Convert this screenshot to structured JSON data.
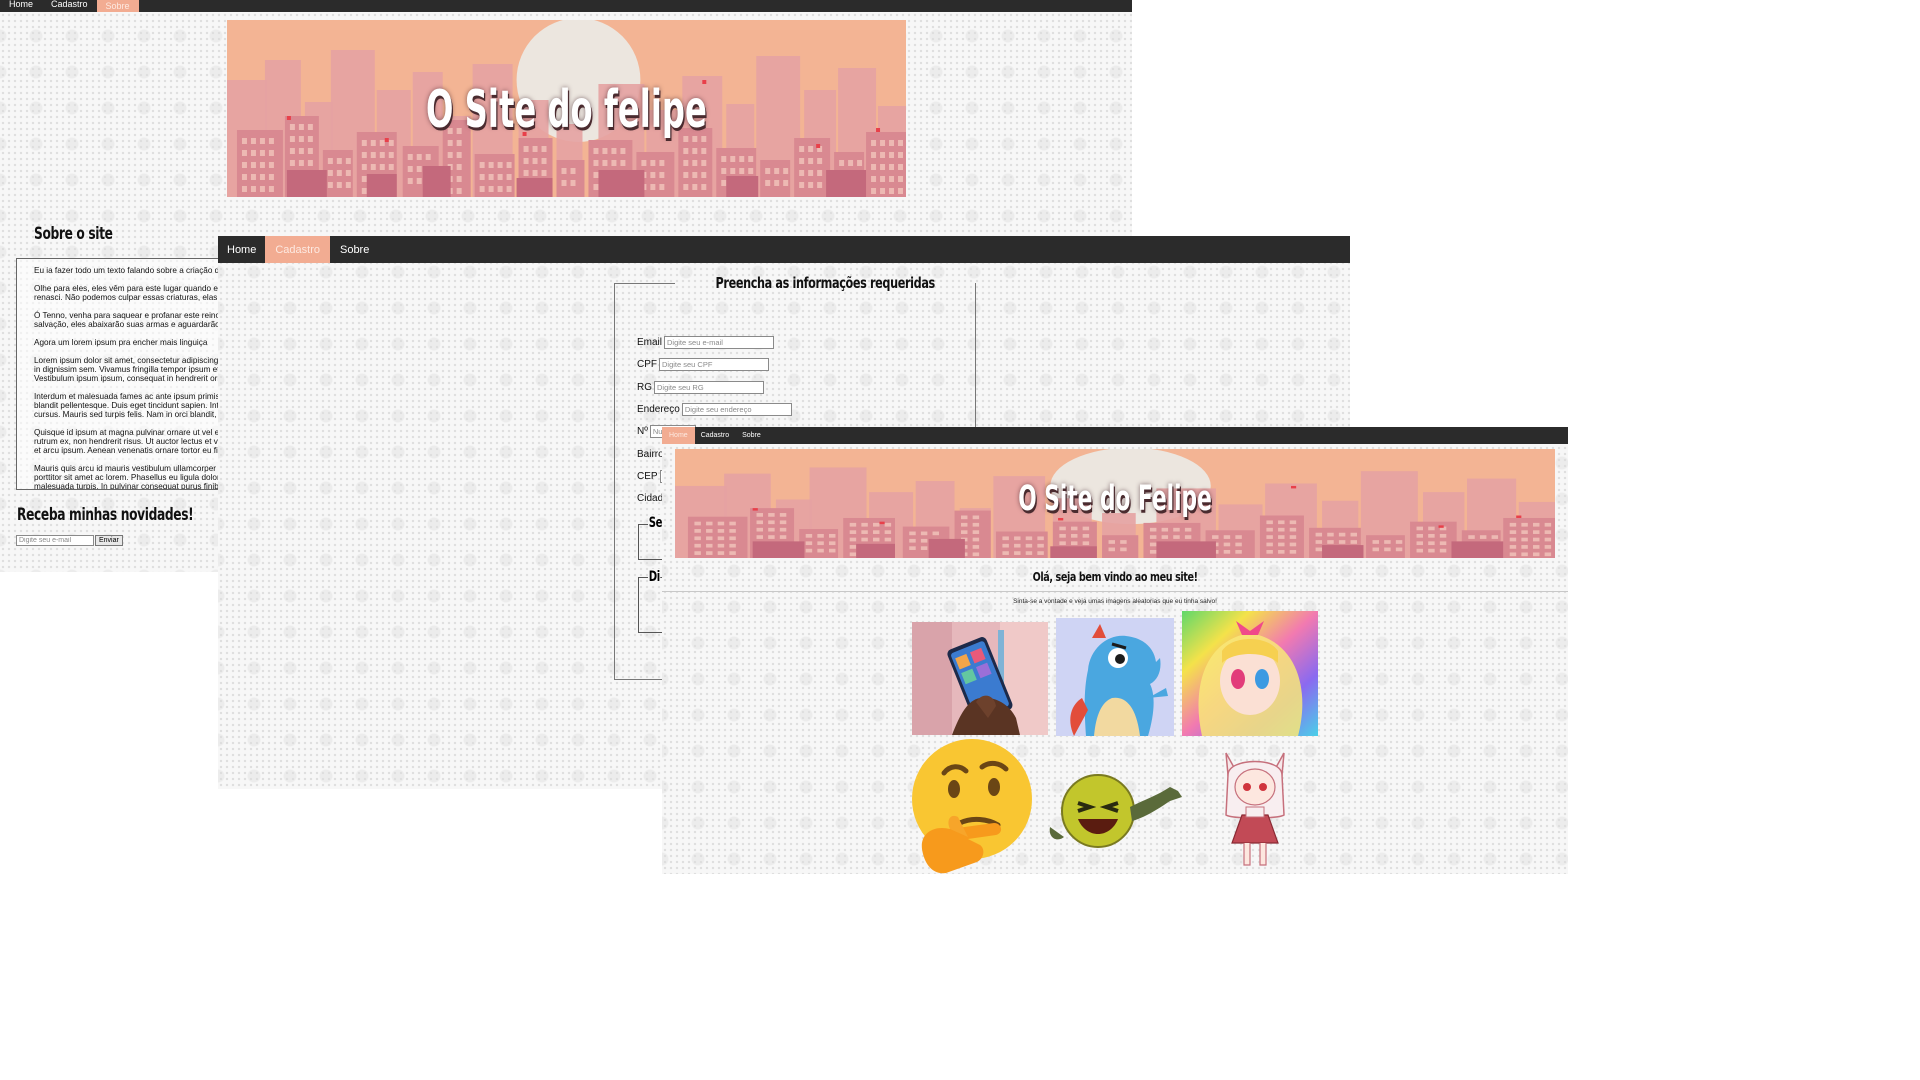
{
  "window1": {
    "nav": [
      "Home",
      "Cadastro",
      "Sobre"
    ],
    "banner_title": "O Site do felipe",
    "about_heading": "Sobre o site",
    "paragraphs": [
      [
        "Eu ia fazer todo um texto falando sobre a criação des"
      ],
      [
        "Olhe para eles, eles vêm para este lugar quando eles",
        "renasci. Não podemos culpar essas criaturas, elas es"
      ],
      [
        "Ó Tenno, venha para saquear e profanar este reino sa",
        "salvação, eles abaixarão suas armas e aguardarão o"
      ],
      [
        "Agora um lorem ipsum pra encher mais linguiça"
      ],
      [
        "Lorem ipsum dolor sit amet, consectetur adipiscing eli",
        "in dignissim sem. Vivamus fringilla tempor ipsum et v",
        "Vestibulum ipsum ipsum, consequat in hendrerit ornar"
      ],
      [
        "Interdum et malesuada fames ac ante ipsum primis in",
        "blandit pellentesque. Duis eget tincidunt sapien. Integ",
        "cursus. Mauris sed turpis felis. Nam in orci blandit, ma"
      ],
      [
        "Quisque id ipsum at magna pulvinar ornare ut vel erat",
        "rutrum ex, non hendrerit risus. Ut auctor lectus et vehi",
        "et arcu ipsum. Aenean venenatis ornare tortor eu finib"
      ],
      [
        "Mauris quis arcu id mauris vestibulum ullamcorper vita",
        "porttitor sit amet ac lorem. Phasellus eu ligula dolor. M",
        "malesuada turpis. In pulvinar consequat purus finibus"
      ]
    ],
    "newsletter_heading": "Receba minhas novidades!",
    "newsletter_placeholder": "Digite seu e-mail",
    "newsletter_button": "Enviar"
  },
  "window2": {
    "nav": [
      "Home",
      "Cadastro",
      "Sobre"
    ],
    "form_legend": "Preencha as informações requeridas",
    "fields": [
      {
        "label": "Email",
        "placeholder": "Digite seu e-mail"
      },
      {
        "label": "CPF",
        "placeholder": "Digite seu CPF"
      },
      {
        "label": "RG",
        "placeholder": "Digite seu RG"
      },
      {
        "label": "Endereço",
        "placeholder": "Digite seu endereço"
      },
      {
        "label": "Nº",
        "placeholder": "Nu"
      },
      {
        "label": "Bairro",
        "placeholder": ""
      },
      {
        "label": "CEP",
        "placeholder": ""
      },
      {
        "label": "Cidade",
        "placeholder": ""
      }
    ],
    "sub_legend_1": "Se",
    "sub_legend_2": "Di"
  },
  "window3": {
    "nav": [
      "Home",
      "Cadastro",
      "Sobre"
    ],
    "banner_title": "O Site do Felipe",
    "welcome": "Olá, seja bem vindo ao meu site!",
    "subtitle": "Sinta-se a vontade e veja umas imagens aleatorias que eu tinha salvo!",
    "images": [
      "phone-in-hand-photo",
      "blue-dinosaur-cartoon",
      "rainbow-anime-girl",
      "thinking-face-emoji",
      "laughing-emoji-arm",
      "chibi-anime-girl"
    ]
  },
  "colors": {
    "nav_bg": "#2b2b2b",
    "nav_active": "#f2ac92",
    "banner_sky": "#f3b494",
    "building_dark": "#c4697c",
    "building_light": "#d98991"
  }
}
